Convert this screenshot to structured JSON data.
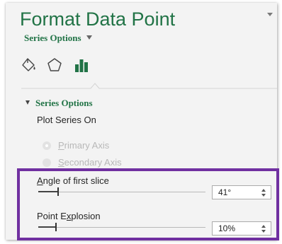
{
  "pane": {
    "title": "Format Data Point",
    "series_dropdown": "Series Options"
  },
  "tabs": [
    {
      "icon": "paint-bucket-icon",
      "active": false
    },
    {
      "icon": "pentagon-icon",
      "active": false
    },
    {
      "icon": "bar-chart-icon",
      "active": true
    }
  ],
  "section": {
    "title": "Series Options",
    "plot_series_on": "Plot Series On",
    "primary_axis": {
      "accel": "P",
      "rest": "rimary Axis",
      "checked": true,
      "disabled": true
    },
    "secondary_axis": {
      "accel": "S",
      "rest": "econdary Axis",
      "checked": false,
      "disabled": true
    }
  },
  "angle": {
    "accel": "A",
    "rest": "ngle of first slice",
    "value": "41°",
    "fraction": 0.114
  },
  "explosion": {
    "before": "Point E",
    "accel": "x",
    "after": "plosion",
    "value": "10%",
    "fraction": 0.1
  },
  "colors": {
    "accent": "#217346",
    "highlight_border": "#7030a0"
  }
}
